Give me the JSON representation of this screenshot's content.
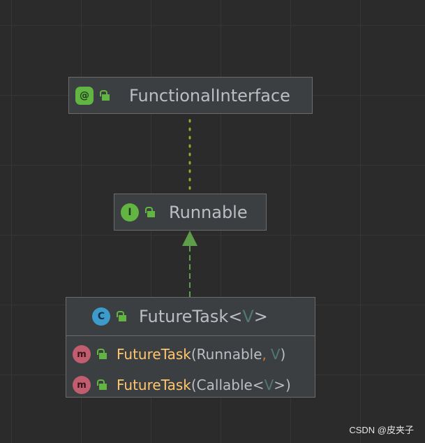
{
  "diagram": {
    "nodes": {
      "functional_interface": {
        "badge": "@",
        "name": "FunctionalInterface"
      },
      "runnable": {
        "badge": "I",
        "name": "Runnable"
      },
      "future_task": {
        "badge": "C",
        "name": "FutureTask",
        "type_param": "V",
        "members": [
          {
            "badge": "m",
            "name": "FutureTask",
            "params_open": "(Runnable",
            "comma": ",",
            "param_type": "V",
            "params_close": ")"
          },
          {
            "badge": "m",
            "name": "FutureTask",
            "params_open": "(Callable<",
            "param_type": "V",
            "params_close": ">)"
          }
        ]
      }
    },
    "edges": [
      {
        "from": "runnable",
        "to": "functional_interface",
        "style": "dotted",
        "color": "#9aa52b"
      },
      {
        "from": "future_task",
        "to": "runnable",
        "style": "dashed-arrow",
        "color": "#5e9d4a"
      }
    ]
  },
  "watermark": "CSDN @皮夹子",
  "colors": {
    "background": "#2b2b2b",
    "node_fill": "#3c3f41",
    "node_border": "#6b6b6b",
    "text": "#bbbec3",
    "method_name": "#ffc66d",
    "type_param": "#507874",
    "comma": "#cc7832",
    "green_badge": "#62b543",
    "class_badge": "#3d9bcc",
    "method_badge": "#c05d6e"
  }
}
